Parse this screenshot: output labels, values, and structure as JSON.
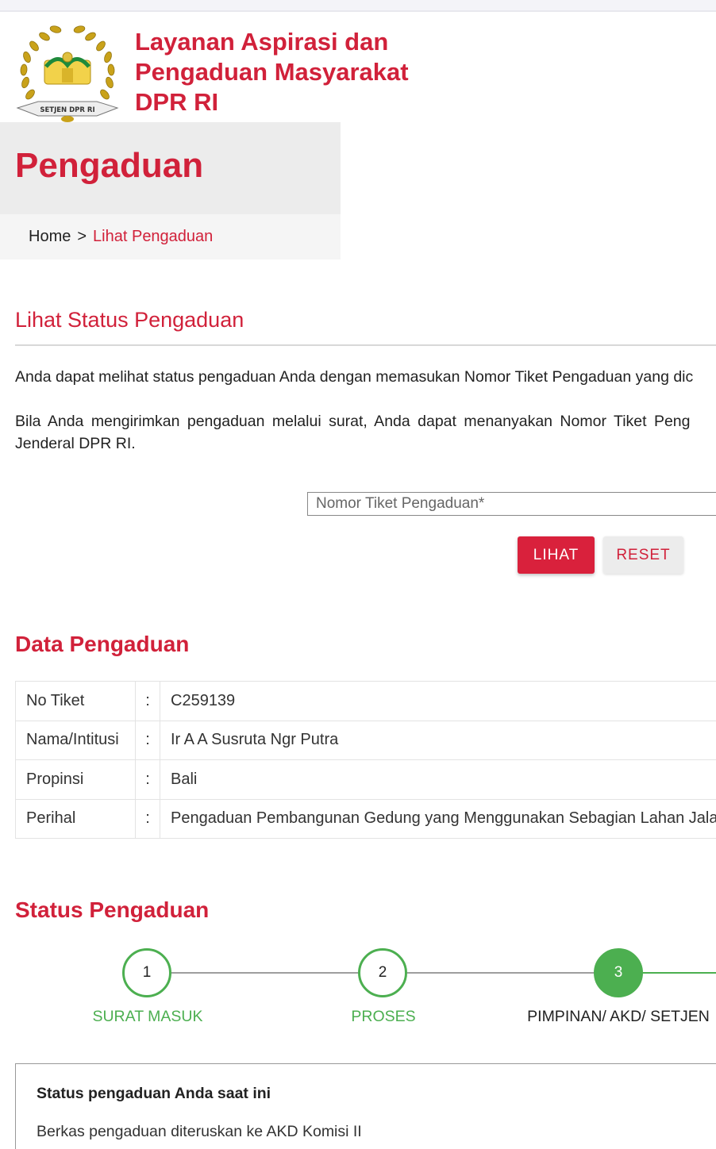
{
  "site": {
    "title_lines": [
      "Layanan Aspirasi dan",
      "Pengaduan Masyarakat",
      "DPR RI"
    ],
    "logo_text": "SETJEN DPR RI",
    "brand_color": "#d1213a"
  },
  "header": {
    "page_title": "Pengaduan",
    "breadcrumb": {
      "home": "Home",
      "separator": ">",
      "current": "Lihat Pengaduan"
    }
  },
  "lookup": {
    "section_title": "Lihat Status Pengaduan",
    "paragraph1": "Anda dapat melihat status pengaduan Anda dengan memasukan Nomor Tiket Pengaduan yang dic",
    "paragraph2_line1": "Bila Anda mengirimkan pengaduan melalui surat, Anda dapat menanyakan Nomor Tiket Peng",
    "paragraph2_line2": "Jenderal DPR RI.",
    "input_placeholder": "Nomor Tiket Pengaduan*",
    "input_value": "",
    "btn_lihat": "LIHAT",
    "btn_reset": "RESET"
  },
  "data_pengaduan": {
    "title": "Data Pengaduan",
    "rows": [
      {
        "key": "No Tiket",
        "colon": ":",
        "value": "C259139"
      },
      {
        "key": "Nama/Intitusi",
        "colon": ":",
        "value": "Ir A A Susruta Ngr Putra"
      },
      {
        "key": "Propinsi",
        "colon": ":",
        "value": "Bali"
      },
      {
        "key": "Perihal",
        "colon": ":",
        "value": "Pengaduan Pembangunan Gedung yang Menggunakan Sebagian Lahan Jala"
      }
    ]
  },
  "status_pengaduan": {
    "title": "Status Pengaduan",
    "steps": [
      {
        "number": "1",
        "label": "SURAT MASUK",
        "state": "done"
      },
      {
        "number": "2",
        "label": "PROSES",
        "state": "done"
      },
      {
        "number": "3",
        "label": "PIMPINAN/ AKD/ SETJEN",
        "state": "active"
      }
    ],
    "current_title": "Status pengaduan Anda saat ini",
    "current_text": "Berkas pengaduan diteruskan ke AKD Komisi II",
    "step_color": "#4caf50"
  }
}
